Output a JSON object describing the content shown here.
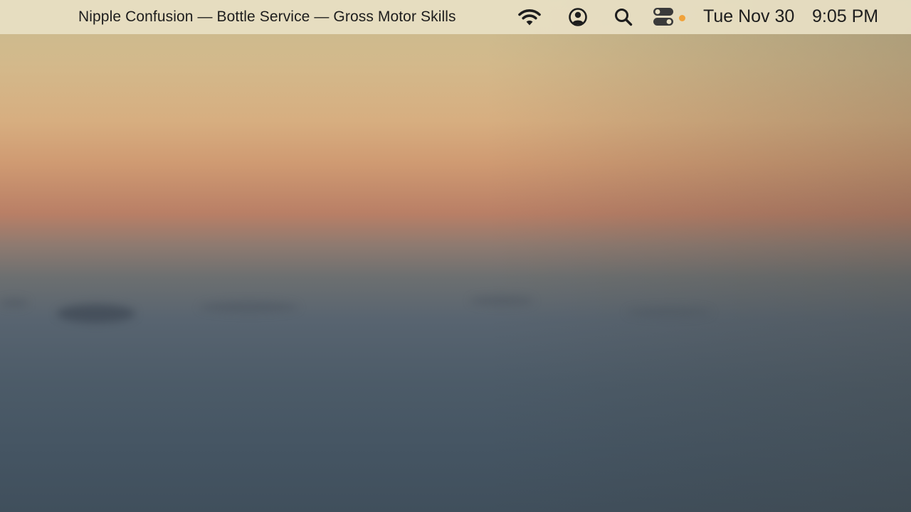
{
  "menubar": {
    "now_playing": "Nipple Confusion — Bottle Service — Gross Motor Skills",
    "icons": [
      "wifi-icon",
      "user-account-icon",
      "search-icon",
      "control-center-icon"
    ],
    "indicator_color": "#f0a23a",
    "date": "Tue Nov 30",
    "time": "9:05 PM"
  },
  "wallpaper": {
    "colors": [
      "#c8bc91",
      "#d7ae80",
      "#b97f66",
      "#586470",
      "#404f5c"
    ]
  }
}
